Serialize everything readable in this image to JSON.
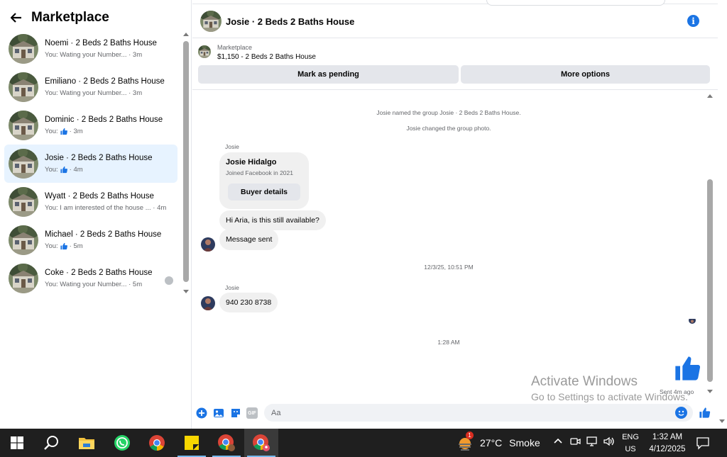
{
  "marketplace": {
    "title": "Marketplace",
    "conversations": [
      {
        "title": "Noemi · 2 Beds 2 Baths House",
        "preview": "You: Wating your Number... · 3m",
        "like": false
      },
      {
        "title": "Emiliano · 2 Beds 2 Baths House",
        "preview": "You: Wating your Number... · 3m",
        "like": false
      },
      {
        "title": "Dominic · 2 Beds 2 Baths House",
        "preview_prefix": "You:",
        "preview_suffix": "· 3m",
        "like": true
      },
      {
        "title": "Josie · 2 Beds 2 Baths House",
        "preview_prefix": "You:",
        "preview_suffix": "· 4m",
        "like": true,
        "active": true
      },
      {
        "title": "Wyatt · 2 Beds 2 Baths House",
        "preview": "You: I am interested of the house ... · 4m",
        "like": false
      },
      {
        "title": "Michael · 2 Beds 2 Baths House",
        "preview_prefix": "You:",
        "preview_suffix": "· 5m",
        "like": true
      },
      {
        "title": "Coke · 2 Beds 2 Baths House",
        "preview": "You: Wating your Number... · 5m",
        "like": false
      }
    ]
  },
  "chat": {
    "title": "Josie · 2 Beds 2 Baths House",
    "listing_kicker": "Marketplace",
    "listing_title": "$1,150 - 2 Beds 2 Baths House",
    "mark_pending": "Mark as pending",
    "more_options": "More options",
    "system_1": "Josie named the group Josie · 2 Beds 2 Baths House.",
    "system_2": "Josie changed the group photo.",
    "sender_1": "Josie",
    "card_name": "Josie Hidalgo",
    "card_sub": "Joined Facebook in 2021",
    "card_button": "Buyer details",
    "msg_1": "Hi Aria, is this still available?",
    "msg_2": "Message sent",
    "time_1": "12/3/25, 10:51 PM",
    "sender_2": "Josie",
    "msg_3": "940 230 8738",
    "time_2": "1:28 AM",
    "sent_status": "Sent 4m ago",
    "composer_placeholder": "Aa",
    "composer_gif": "GIF"
  },
  "watermark": {
    "line1": "Activate Windows",
    "line2": "Go to Settings to activate Windows."
  },
  "taskbar": {
    "weather_temp": "27°C",
    "weather_desc": "Smoke",
    "weather_badge": "1",
    "lang_1": "ENG",
    "lang_2": "US",
    "time": "1:32 AM",
    "date": "4/12/2025"
  },
  "colors": {
    "accent": "#1b74e4",
    "active_row": "#e7f3ff",
    "bubble": "#f0f0f0",
    "taskbar": "#1f1f1f"
  }
}
